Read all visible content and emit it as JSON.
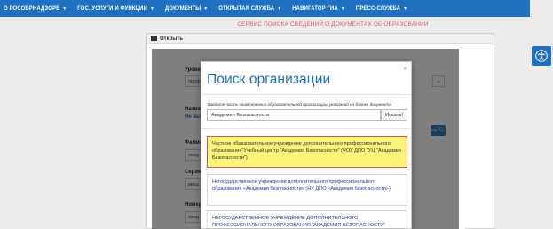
{
  "nav": {
    "items": [
      {
        "label": "О РОСОБРНАДЗОРЕ"
      },
      {
        "label": "ГОС. УСЛУГИ И ФУНКЦИИ"
      },
      {
        "label": "ДОКУМЕНТЫ"
      },
      {
        "label": "ОТКРЫТАЯ СЛУЖБА"
      },
      {
        "label": "НАВИГАТОР ГИА"
      },
      {
        "label": "ПРЕСС-СЛУЖБА"
      }
    ]
  },
  "banner": "СЕРВИС ПОИСКА СВЕДЕНИЙ О ДОКУМЕНТАХ ОБ ОБРАЗОВАНИИ",
  "panel": {
    "title": "Открыть"
  },
  "background_form": {
    "level_label": "Уровен",
    "level_value": "проф",
    "name_label": "Назван",
    "not_chosen": "Не выбр",
    "surname_label": "Фамил",
    "series_label": "Серия",
    "number_label": "Номер",
    "input_placeholder": "введ",
    "search_button": "ка"
  },
  "modal": {
    "title": "Поиск организации",
    "close": "×",
    "hint": "Введите часть наименования образовательной организации, указанной на бланке документа",
    "search_value": "Академия Безопасности",
    "search_button": "Искать!",
    "results": [
      {
        "text": "Частное образовательное учреждение дополнительного профессионального образования\"Учебный центр \"Академия Безопасности\" (ЧОУ ДПО \"УЦ \"Академия Безопасности\")",
        "highlighted": true
      },
      {
        "text": "Негосударственное учреждение дополнительного профессионального образования «Академия безопасности» (НУ ДПО «Академия безопасности»)",
        "highlighted": false
      },
      {
        "text": "НЕГОСУДАРСТВЕННОЕ УЧРЕЖДЕНИЕ ДОПОЛНИТЕЛЬНОГО ПРОФЕССИОНАЛЬНОГО ОБРАЗОВАНИЯ \"АКАДЕМИЯ БЕЗОПАСНОСТИ\"",
        "highlighted": false
      }
    ]
  },
  "colors": {
    "brand": "#1f70c1",
    "highlight": "#fdf27a",
    "highlight_border": "#d9534f",
    "banner": "#e05a5a"
  },
  "icons": {
    "accessibility": "accessibility-icon",
    "folder": "folder-icon",
    "caret": "chevron-down-icon"
  }
}
